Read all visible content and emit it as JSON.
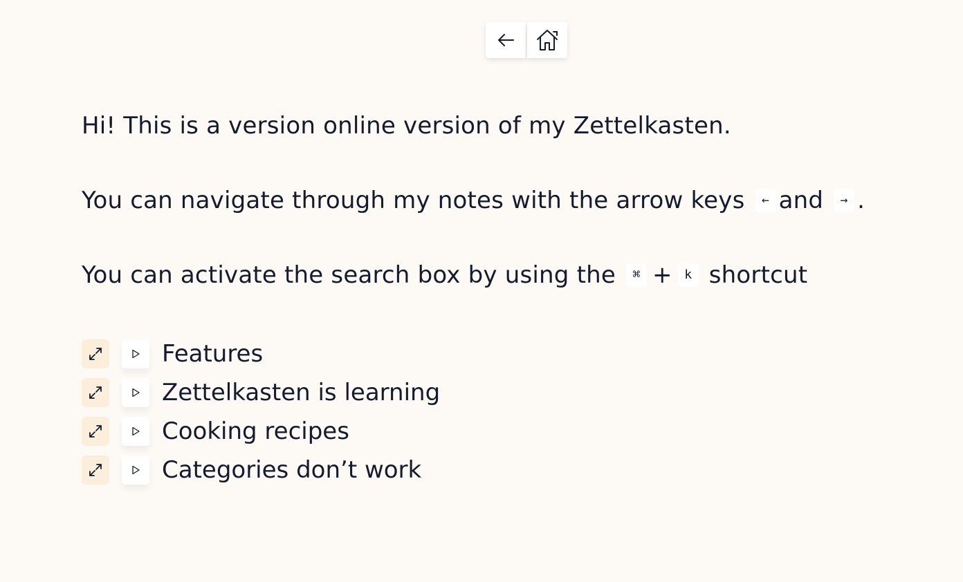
{
  "nav": {
    "back_icon": "arrow-left-icon",
    "home_icon": "home-icon"
  },
  "intro": {
    "line1": "Hi! This is a version online version of my Zettelkasten.",
    "line2_text": "You can navigate through my notes with the arrow keys",
    "line2_key_left": "←",
    "line2_and": "and",
    "line2_key_right": "→",
    "line2_end": ".",
    "line3_text": "You can activate the search box by using the",
    "line3_key_cmd": "⌘",
    "line3_plus": "+",
    "line3_key_k": "k",
    "line3_end": "shortcut"
  },
  "notes": [
    {
      "label": "Features"
    },
    {
      "label": "Zettelkasten is learning"
    },
    {
      "label": "Cooking recipes"
    },
    {
      "label": "Categories don’t work"
    }
  ],
  "icons": {
    "expand": "expand-icon",
    "play": "play-triangle-icon"
  },
  "colors": {
    "background": "#fdfaf6",
    "text": "#141b2d",
    "expand_bg": "#fbeedb",
    "button_bg": "#ffffff"
  }
}
